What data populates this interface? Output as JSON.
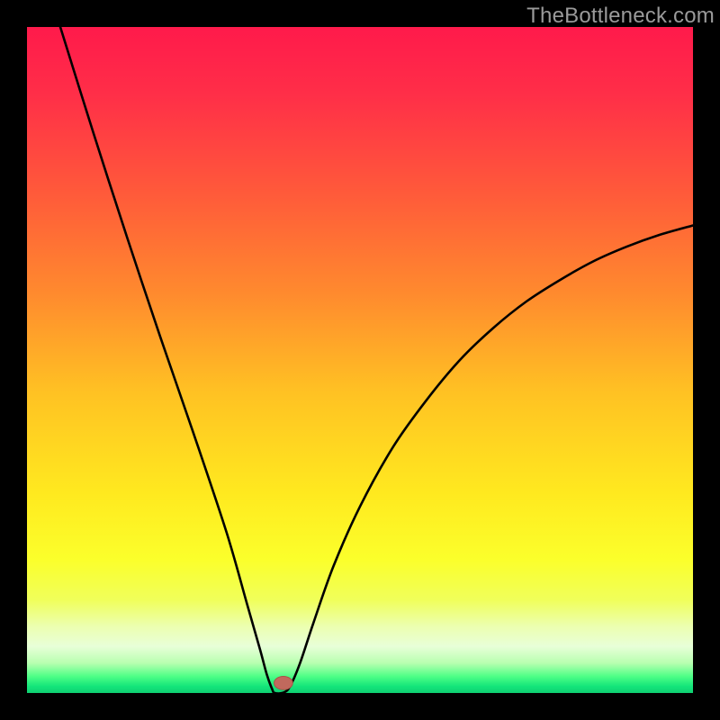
{
  "watermark": "TheBottleneck.com",
  "colors": {
    "frame": "#000000",
    "gradient_stops": [
      {
        "offset": 0.0,
        "color": "#ff1a4b"
      },
      {
        "offset": 0.1,
        "color": "#ff2e48"
      },
      {
        "offset": 0.25,
        "color": "#ff5a3a"
      },
      {
        "offset": 0.4,
        "color": "#ff8a2e"
      },
      {
        "offset": 0.55,
        "color": "#ffc223"
      },
      {
        "offset": 0.7,
        "color": "#ffe91f"
      },
      {
        "offset": 0.8,
        "color": "#fbff2b"
      },
      {
        "offset": 0.86,
        "color": "#f0ff5a"
      },
      {
        "offset": 0.9,
        "color": "#ecffb0"
      },
      {
        "offset": 0.93,
        "color": "#e8ffd8"
      },
      {
        "offset": 0.955,
        "color": "#b8ffb0"
      },
      {
        "offset": 0.975,
        "color": "#4eff86"
      },
      {
        "offset": 0.99,
        "color": "#14e57a"
      },
      {
        "offset": 1.0,
        "color": "#0fd072"
      }
    ],
    "curve": "#000000",
    "marker_fill": "#c1695d",
    "marker_stroke": "#a95347"
  },
  "chart_data": {
    "type": "line",
    "title": "",
    "xlabel": "",
    "ylabel": "",
    "x_range": [
      0,
      100
    ],
    "y_range": [
      0,
      100
    ],
    "minimum_point": {
      "x": 37,
      "y": 0
    },
    "left_branch_start": {
      "x": 5,
      "y": 100
    },
    "right_branch_end": {
      "x": 100,
      "y": 70
    },
    "marker": {
      "x": 38.5,
      "y": 1.5,
      "rx_pct": 1.4,
      "ry_pct": 1.0
    },
    "curve_points_pct": [
      {
        "x": 5.0,
        "y": 100.0
      },
      {
        "x": 10.0,
        "y": 84.0
      },
      {
        "x": 15.0,
        "y": 68.5
      },
      {
        "x": 20.0,
        "y": 53.5
      },
      {
        "x": 25.0,
        "y": 39.0
      },
      {
        "x": 30.0,
        "y": 24.0
      },
      {
        "x": 33.0,
        "y": 13.5
      },
      {
        "x": 35.0,
        "y": 6.5
      },
      {
        "x": 36.0,
        "y": 2.8
      },
      {
        "x": 36.8,
        "y": 0.6
      },
      {
        "x": 37.2,
        "y": 0.0
      },
      {
        "x": 38.5,
        "y": 0.05
      },
      {
        "x": 39.5,
        "y": 1.0
      },
      {
        "x": 41.0,
        "y": 4.5
      },
      {
        "x": 43.0,
        "y": 10.5
      },
      {
        "x": 46.0,
        "y": 19.0
      },
      {
        "x": 50.0,
        "y": 28.0
      },
      {
        "x": 55.0,
        "y": 37.0
      },
      {
        "x": 60.0,
        "y": 44.0
      },
      {
        "x": 65.0,
        "y": 50.0
      },
      {
        "x": 70.0,
        "y": 54.8
      },
      {
        "x": 75.0,
        "y": 58.8
      },
      {
        "x": 80.0,
        "y": 62.0
      },
      {
        "x": 85.0,
        "y": 64.8
      },
      {
        "x": 90.0,
        "y": 67.0
      },
      {
        "x": 95.0,
        "y": 68.8
      },
      {
        "x": 100.0,
        "y": 70.2
      }
    ]
  }
}
